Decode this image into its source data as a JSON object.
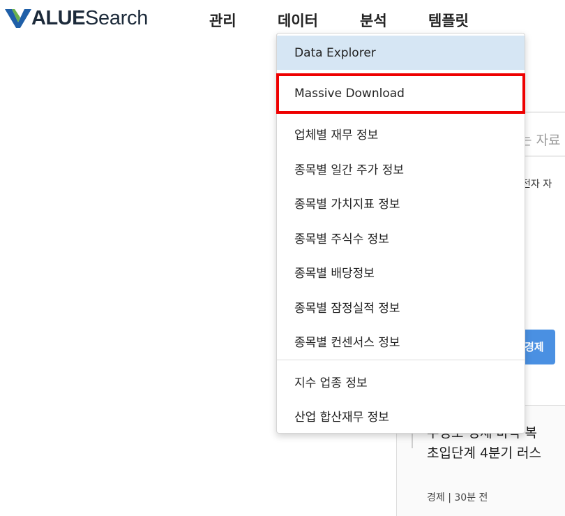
{
  "header": {
    "logo": {
      "bold_text": "ALUE",
      "light_text": "Search",
      "mark_color": "#1f5fa8",
      "accent_color": "#6ab04c"
    },
    "nav": [
      {
        "label": "관리"
      },
      {
        "label": "데이터"
      },
      {
        "label": "분석"
      },
      {
        "label": "템플릿"
      }
    ]
  },
  "dropdown": {
    "items": [
      {
        "label": "Data Explorer",
        "active": true
      },
      {
        "label": "Massive Download",
        "highlighted": true
      },
      {
        "label": "업체별 재무 정보"
      },
      {
        "label": "종목별 일간 주가 정보"
      },
      {
        "label": "종목별 가치지표 정보"
      },
      {
        "label": "종목별 주식수 정보"
      },
      {
        "label": "종목별 배당정보"
      },
      {
        "label": "종목별 잠정실적 정보"
      },
      {
        "label": "종목별 컨센서스 정보"
      },
      {
        "label": "지수 업종 정보"
      },
      {
        "label": "산업 합산재무 정보"
      }
    ],
    "highlight_color": "#ee0000",
    "active_bg": "#d6e6f4"
  },
  "background": {
    "search_placeholder": "는 자료",
    "hint_text": "전자 자",
    "category_chip": "경제",
    "news": {
      "title": "수정보 경제 바닥 복 초입단계 4분기 러스",
      "meta": "경제 | 30분 전"
    }
  }
}
